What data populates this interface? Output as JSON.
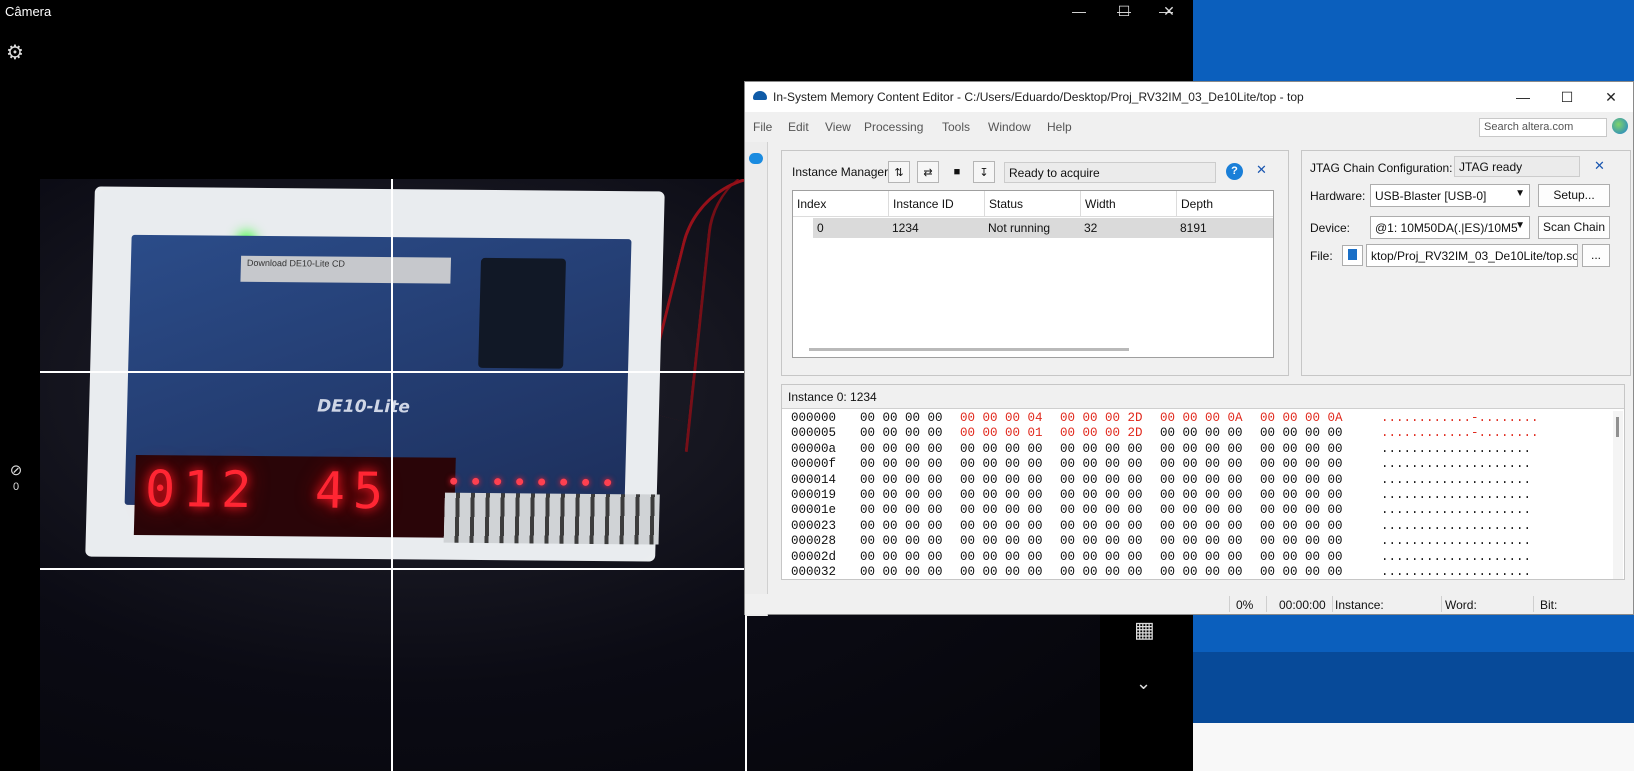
{
  "camera": {
    "title": "Câmera",
    "timer_count": "0",
    "board": {
      "label_text": "Download DE10-Lite CD",
      "model": "DE10-Lite",
      "seven_seg_left": "012",
      "seven_seg_right": "45"
    }
  },
  "ismce": {
    "title": "In-System Memory Content Editor - C:/Users/Eduardo/Desktop/Proj_RV32IM_03_De10Lite/top - top",
    "menu": [
      "File",
      "Edit",
      "View",
      "Processing",
      "Tools",
      "Window",
      "Help"
    ],
    "search_placeholder": "Search altera.com",
    "instance_manager": {
      "label": "Instance Manager:",
      "status": "Ready to acquire",
      "help": "?",
      "columns": [
        "Index",
        "Instance ID",
        "Status",
        "Width",
        "Depth"
      ],
      "rows": [
        {
          "index": "0",
          "instance_id": "1234",
          "status": "Not running",
          "width": "32",
          "depth": "8191"
        }
      ]
    },
    "jtag": {
      "label": "JTAG Chain Configuration:",
      "status": "JTAG ready",
      "hardware_label": "Hardware:",
      "hardware_value": "USB-Blaster [USB-0]",
      "setup_button": "Setup...",
      "device_label": "Device:",
      "device_value": "@1: 10M50DA(.|ES)/10M5",
      "scan_button": "Scan Chain",
      "file_label": "File:",
      "file_value": "ktop/Proj_RV32IM_03_De10Lite/top.sof",
      "browse_button": "..."
    },
    "memory": {
      "header": "Instance 0: 1234",
      "rows": [
        {
          "addr": "000000",
          "words": [
            "00 00 00 00",
            "00 00 00 04",
            "00 00 00 2D",
            "00 00 00 0A",
            "00 00 00 0A"
          ],
          "red": [
            false,
            true,
            true,
            true,
            true
          ],
          "ascii": "............-........",
          "ascii_red": true
        },
        {
          "addr": "000005",
          "words": [
            "00 00 00 00",
            "00 00 00 01",
            "00 00 00 2D",
            "00 00 00 00",
            "00 00 00 00"
          ],
          "red": [
            false,
            true,
            true,
            false,
            false
          ],
          "ascii": "............-........",
          "ascii_red": true
        },
        {
          "addr": "00000a",
          "words": [
            "00 00 00 00",
            "00 00 00 00",
            "00 00 00 00",
            "00 00 00 00",
            "00 00 00 00"
          ],
          "red": [
            false,
            false,
            false,
            false,
            false
          ],
          "ascii": "....................",
          "ascii_red": false
        },
        {
          "addr": "00000f",
          "words": [
            "00 00 00 00",
            "00 00 00 00",
            "00 00 00 00",
            "00 00 00 00",
            "00 00 00 00"
          ],
          "red": [
            false,
            false,
            false,
            false,
            false
          ],
          "ascii": "....................",
          "ascii_red": false
        },
        {
          "addr": "000014",
          "words": [
            "00 00 00 00",
            "00 00 00 00",
            "00 00 00 00",
            "00 00 00 00",
            "00 00 00 00"
          ],
          "red": [
            false,
            false,
            false,
            false,
            false
          ],
          "ascii": "....................",
          "ascii_red": false
        },
        {
          "addr": "000019",
          "words": [
            "00 00 00 00",
            "00 00 00 00",
            "00 00 00 00",
            "00 00 00 00",
            "00 00 00 00"
          ],
          "red": [
            false,
            false,
            false,
            false,
            false
          ],
          "ascii": "....................",
          "ascii_red": false
        },
        {
          "addr": "00001e",
          "words": [
            "00 00 00 00",
            "00 00 00 00",
            "00 00 00 00",
            "00 00 00 00",
            "00 00 00 00"
          ],
          "red": [
            false,
            false,
            false,
            false,
            false
          ],
          "ascii": "....................",
          "ascii_red": false
        },
        {
          "addr": "000023",
          "words": [
            "00 00 00 00",
            "00 00 00 00",
            "00 00 00 00",
            "00 00 00 00",
            "00 00 00 00"
          ],
          "red": [
            false,
            false,
            false,
            false,
            false
          ],
          "ascii": "....................",
          "ascii_red": false
        },
        {
          "addr": "000028",
          "words": [
            "00 00 00 00",
            "00 00 00 00",
            "00 00 00 00",
            "00 00 00 00",
            "00 00 00 00"
          ],
          "red": [
            false,
            false,
            false,
            false,
            false
          ],
          "ascii": "....................",
          "ascii_red": false
        },
        {
          "addr": "00002d",
          "words": [
            "00 00 00 00",
            "00 00 00 00",
            "00 00 00 00",
            "00 00 00 00",
            "00 00 00 00"
          ],
          "red": [
            false,
            false,
            false,
            false,
            false
          ],
          "ascii": "....................",
          "ascii_red": false
        },
        {
          "addr": "000032",
          "words": [
            "00 00 00 00",
            "00 00 00 00",
            "00 00 00 00",
            "00 00 00 00",
            "00 00 00 00"
          ],
          "red": [
            false,
            false,
            false,
            false,
            false
          ],
          "ascii": "....................",
          "ascii_red": false
        }
      ]
    },
    "statusbar": {
      "progress": "0%",
      "time": "00:00:00",
      "instance_label": "Instance:",
      "word_label": "Word:",
      "bit_label": "Bit:"
    }
  },
  "colors": {
    "accent_blue": "#0b5fbd",
    "hex_changed_red": "#e0281c",
    "seven_segment_red": "#ff2633"
  }
}
